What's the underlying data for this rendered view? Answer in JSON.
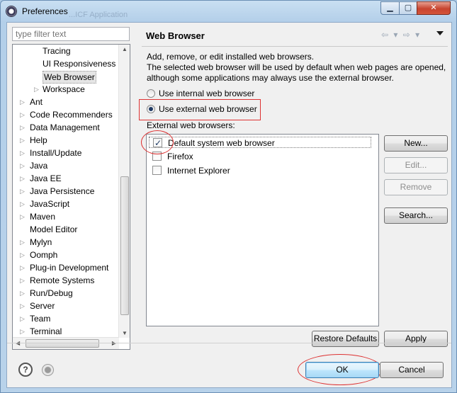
{
  "window": {
    "title": "Preferences",
    "ghost_title": "...ICF Application",
    "controls": {
      "minimize": "▁",
      "maximize": "▢",
      "close": "✕"
    }
  },
  "sidebar": {
    "filter_placeholder": "type filter text",
    "items": [
      {
        "label": "Tracing",
        "arrow": ""
      },
      {
        "label": "UI Responsiveness M",
        "arrow": ""
      },
      {
        "label": "Web Browser",
        "arrow": "",
        "selected": true
      },
      {
        "label": "Workspace",
        "arrow": "▷"
      },
      {
        "label": "Ant",
        "arrow": "▷"
      },
      {
        "label": "Code Recommenders",
        "arrow": "▷"
      },
      {
        "label": "Data Management",
        "arrow": "▷"
      },
      {
        "label": "Help",
        "arrow": "▷"
      },
      {
        "label": "Install/Update",
        "arrow": "▷"
      },
      {
        "label": "Java",
        "arrow": "▷"
      },
      {
        "label": "Java EE",
        "arrow": "▷"
      },
      {
        "label": "Java Persistence",
        "arrow": "▷"
      },
      {
        "label": "JavaScript",
        "arrow": "▷"
      },
      {
        "label": "Maven",
        "arrow": "▷"
      },
      {
        "label": "Model Editor",
        "arrow": ""
      },
      {
        "label": "Mylyn",
        "arrow": "▷"
      },
      {
        "label": "Oomph",
        "arrow": "▷"
      },
      {
        "label": "Plug-in Development",
        "arrow": "▷"
      },
      {
        "label": "Remote Systems",
        "arrow": "▷"
      },
      {
        "label": "Run/Debug",
        "arrow": "▷"
      },
      {
        "label": "Server",
        "arrow": "▷"
      },
      {
        "label": "Team",
        "arrow": "▷"
      },
      {
        "label": "Terminal",
        "arrow": "▷"
      }
    ]
  },
  "page": {
    "title": "Web Browser",
    "nav": {
      "back": "⇦ ▾ ⇨ ▾"
    },
    "description": [
      "Add, remove, or edit installed web browsers.",
      "The selected web browser will be used by default when web pages are opened,",
      "although some applications may always use the external browser."
    ],
    "radio_internal": "Use internal web browser",
    "radio_external": "Use external web browser",
    "external_label": "External web browsers:",
    "browsers": [
      {
        "label": "Default system web browser",
        "checked": true
      },
      {
        "label": "Firefox",
        "checked": false
      },
      {
        "label": "Internet Explorer",
        "checked": false
      }
    ],
    "buttons": {
      "new": "New...",
      "edit": "Edit...",
      "remove": "Remove",
      "search": "Search...",
      "restore_defaults": "Restore Defaults",
      "apply": "Apply"
    }
  },
  "footer": {
    "help_icon": "?",
    "ok": "OK",
    "cancel": "Cancel"
  },
  "colors": {
    "annotation": "#dd3333",
    "selection": "#e5e5e5"
  }
}
